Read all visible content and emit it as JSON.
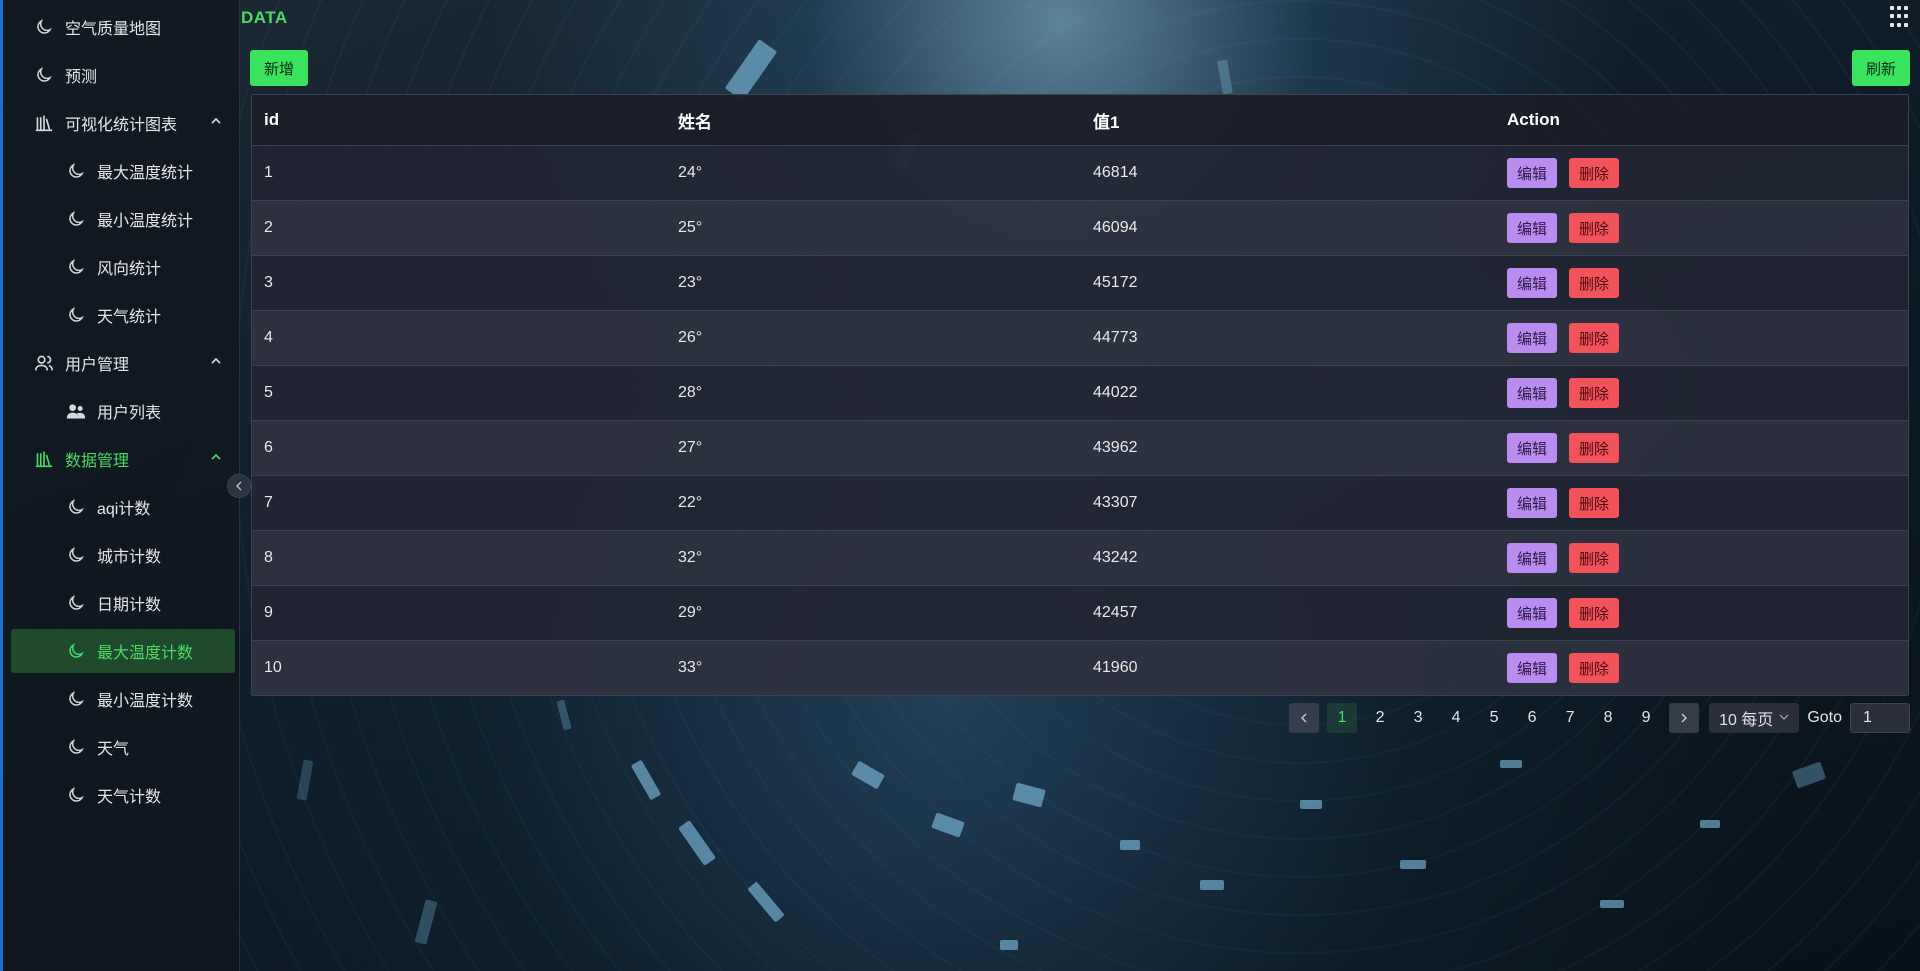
{
  "brand": "DATA",
  "sidebar": {
    "items": [
      {
        "label": "空气质量地图",
        "icon": "moon-icon"
      },
      {
        "label": "预测",
        "icon": "moon-icon"
      },
      {
        "label": "可视化统计图表",
        "icon": "chart-library-icon"
      },
      {
        "label": "最大温度统计",
        "icon": "moon-icon"
      },
      {
        "label": "最小温度统计",
        "icon": "moon-icon"
      },
      {
        "label": "风向统计",
        "icon": "moon-icon"
      },
      {
        "label": "天气统计",
        "icon": "moon-icon"
      },
      {
        "label": "用户管理",
        "icon": "users-outline-icon"
      },
      {
        "label": "用户列表",
        "icon": "users-solid-icon"
      },
      {
        "label": "数据管理",
        "icon": "chart-library-icon"
      },
      {
        "label": "aqi计数",
        "icon": "moon-icon"
      },
      {
        "label": "城市计数",
        "icon": "moon-icon"
      },
      {
        "label": "日期计数",
        "icon": "moon-icon"
      },
      {
        "label": "最大温度计数",
        "icon": "moon-icon"
      },
      {
        "label": "最小温度计数",
        "icon": "moon-icon"
      },
      {
        "label": "天气",
        "icon": "moon-icon"
      },
      {
        "label": "天气计数",
        "icon": "moon-icon"
      }
    ]
  },
  "toolbar": {
    "add_label": "新增",
    "refresh_label": "刷新"
  },
  "table": {
    "columns": [
      "id",
      "姓名",
      "值1",
      "Action"
    ],
    "rows": [
      {
        "id": "1",
        "name": "24°",
        "value": "46814"
      },
      {
        "id": "2",
        "name": "25°",
        "value": "46094"
      },
      {
        "id": "3",
        "name": "23°",
        "value": "45172"
      },
      {
        "id": "4",
        "name": "26°",
        "value": "44773"
      },
      {
        "id": "5",
        "name": "28°",
        "value": "44022"
      },
      {
        "id": "6",
        "name": "27°",
        "value": "43962"
      },
      {
        "id": "7",
        "name": "22°",
        "value": "43307"
      },
      {
        "id": "8",
        "name": "32°",
        "value": "43242"
      },
      {
        "id": "9",
        "name": "29°",
        "value": "42457"
      },
      {
        "id": "10",
        "name": "33°",
        "value": "41960"
      }
    ],
    "edit_label": "编辑",
    "delete_label": "删除"
  },
  "pagination": {
    "pages": [
      "1",
      "2",
      "3",
      "4",
      "5",
      "6",
      "7",
      "8",
      "9"
    ],
    "current": "1",
    "page_size": "10 每页",
    "goto_label": "Goto",
    "goto_value": "1"
  },
  "colors": {
    "accent_green": "#4cd964",
    "button_green": "#39e35e",
    "edit_purple": "#bb8cf0",
    "delete_red": "#f2525a"
  }
}
